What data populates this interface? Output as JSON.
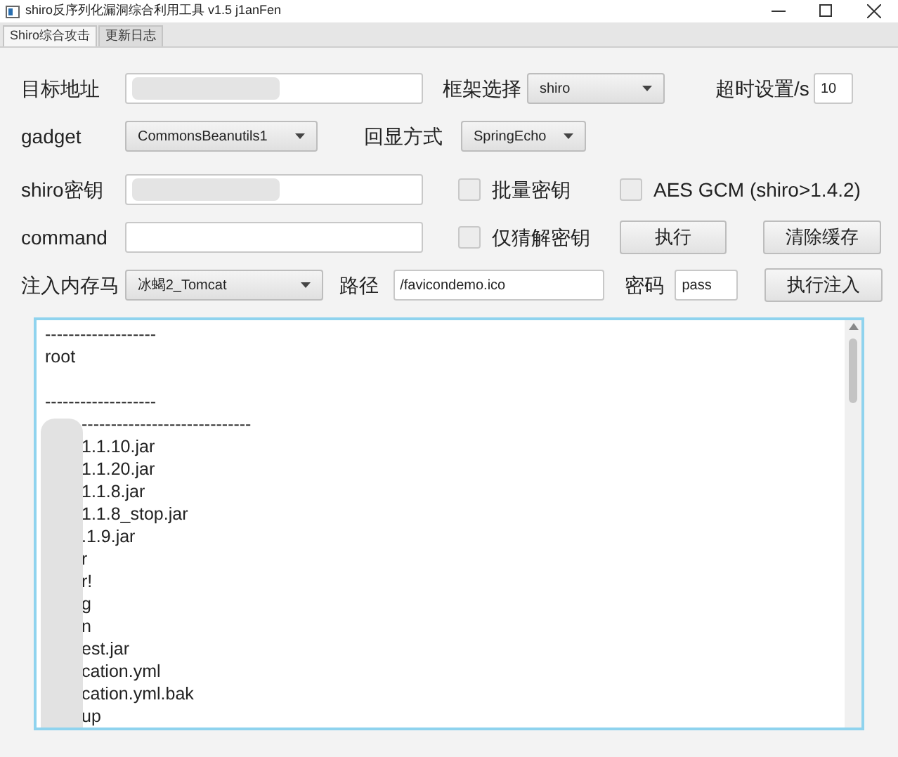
{
  "window": {
    "title": "shiro反序列化漏洞综合利用工具 v1.5  j1anFen"
  },
  "tabs": [
    {
      "label": "Shiro综合攻击",
      "selected": true
    },
    {
      "label": "更新日志",
      "selected": false
    }
  ],
  "form": {
    "target": {
      "label": "目标地址",
      "redacted": true
    },
    "framework": {
      "label": "框架选择",
      "value": "shiro"
    },
    "timeout": {
      "label": "超时设置/s",
      "value": "10"
    },
    "gadget": {
      "label": "gadget",
      "value": "CommonsBeanutils1"
    },
    "echo": {
      "label": "回显方式",
      "value": "SpringEcho"
    },
    "key": {
      "label": "shiro密钥",
      "redacted": true
    },
    "batch_key": {
      "label": "批量密钥",
      "checked": false
    },
    "aes_gcm": {
      "label": "AES GCM (shiro>1.4.2)",
      "checked": false
    },
    "command": {
      "label": "command"
    },
    "guess_only": {
      "label": "仅猜解密钥",
      "checked": false
    },
    "execute_button": "执行",
    "clear_cache_button": "清除缓存",
    "memshell": {
      "label": "注入内存马",
      "value": "冰蝎2_Tomcat"
    },
    "path": {
      "label": "路径",
      "value": "/favicondemo.ico"
    },
    "password": {
      "label": "密码",
      "value": "pass"
    },
    "inject_button": "执行注入"
  },
  "output": {
    "groups": [
      [
        "-------------------",
        "root"
      ],
      [
        "-------------------",
        "-----------------------------",
        "1.1.10.jar",
        "1.1.20.jar",
        "1.1.8.jar",
        "1.1.8_stop.jar",
        ".1.9.jar",
        "r",
        "r!",
        "g",
        "n",
        "est.jar",
        "cation.yml",
        "cation.yml.bak",
        "up"
      ]
    ],
    "redacted": true
  }
}
